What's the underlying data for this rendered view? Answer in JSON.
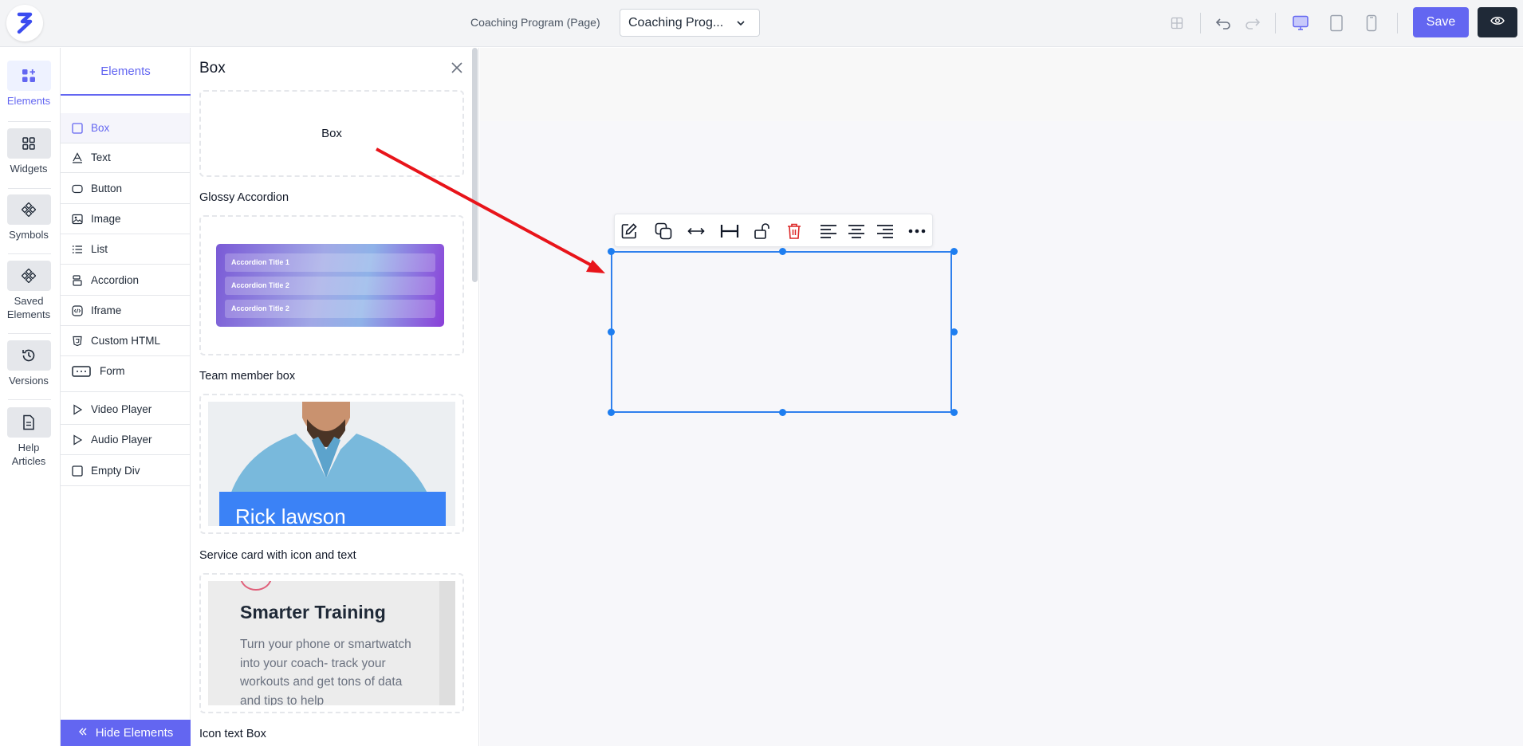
{
  "header": {
    "page_label": "Coaching Program (Page)",
    "page_select_value": "Coaching Prog...",
    "save_label": "Save"
  },
  "rail": {
    "items": [
      {
        "label": "Elements",
        "icon": "elements-icon"
      },
      {
        "label": "Widgets",
        "icon": "widgets-icon"
      },
      {
        "label": "Symbols",
        "icon": "symbols-icon"
      },
      {
        "label": "Saved Elements",
        "icon": "saved-elements-icon"
      },
      {
        "label": "Versions",
        "icon": "history-icon"
      },
      {
        "label": "Help Articles",
        "icon": "document-icon"
      }
    ]
  },
  "elements_list": {
    "tab_label": "Elements",
    "items": [
      {
        "label": "Box",
        "icon": "box-icon"
      },
      {
        "label": "Text",
        "icon": "text-icon"
      },
      {
        "label": "Button",
        "icon": "button-icon"
      },
      {
        "label": "Image",
        "icon": "image-icon"
      },
      {
        "label": "List",
        "icon": "list-icon"
      },
      {
        "label": "Accordion",
        "icon": "accordion-icon"
      },
      {
        "label": "Iframe",
        "icon": "iframe-icon"
      },
      {
        "label": "Custom HTML",
        "icon": "html-icon"
      },
      {
        "label": "Form",
        "icon": "form-icon"
      },
      {
        "label": "Video Player",
        "icon": "play-icon"
      },
      {
        "label": "Audio Player",
        "icon": "play-icon"
      },
      {
        "label": "Empty Div",
        "icon": "empty-div-icon"
      }
    ],
    "hide_label": "Hide Elements"
  },
  "panel": {
    "title": "Box",
    "box_card_label": "Box",
    "sections": {
      "glossy_accordion": "Glossy Accordion",
      "team_member": "Team member box",
      "service_card": "Service card with icon and text",
      "icon_text_box": "Icon text Box"
    },
    "accordion_items": [
      "Accordion Title 1",
      "Accordion Title 2",
      "Accordion Title 2"
    ],
    "team_member_name": "Rick lawson",
    "service_card_title": "Smarter Training",
    "service_card_text": "Turn your phone or smartwatch into your coach- track your workouts and get tons of data and tips to help"
  },
  "colors": {
    "accent": "#6366f1",
    "selection": "#2f80ed",
    "delete": "#dc2626",
    "arrow": "#e8141a"
  }
}
